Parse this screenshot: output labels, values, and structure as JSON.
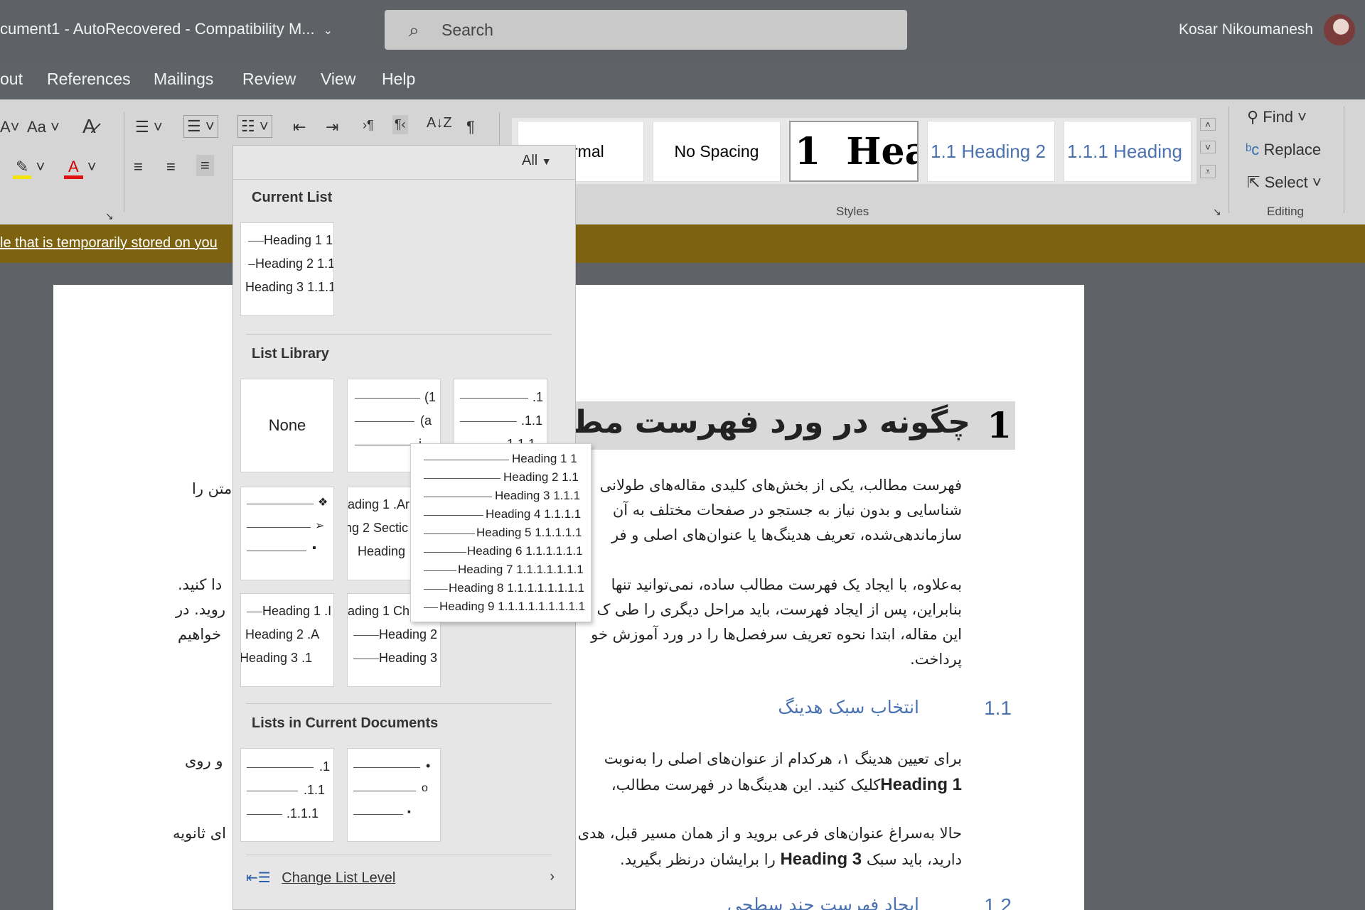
{
  "title_bar": {
    "doc_title": "cument1  -  AutoRecovered  -  Compatibility M...",
    "search_placeholder": "Search",
    "user_name": "Kosar Nikoumanesh"
  },
  "menu": [
    "out",
    "References",
    "Mailings",
    "Review",
    "View",
    "Help"
  ],
  "ribbon": {
    "font_case": "Aa",
    "styles": {
      "normal": "rmal",
      "no_spacing": "No Spacing",
      "heading1_num": "1",
      "heading1": "Head",
      "heading2": "1.1  Heading 2",
      "heading3": "1.1.1  Heading"
    },
    "styles_label": "Styles",
    "editing": {
      "find": "Find",
      "replace": "Replace",
      "select": "Select",
      "label": "Editing"
    }
  },
  "notification": "le that is temporarily stored on you",
  "dropdown": {
    "filter": "All",
    "current_list_header": "Current List",
    "current_list": [
      "Heading 1 1",
      "Heading 2 1.1",
      "Heading 3 1.1.1"
    ],
    "library_header": "List Library",
    "none_label": "None",
    "tile_paren": [
      "(1",
      "(a",
      "i"
    ],
    "tile_decimal": [
      ".1",
      ".1.1",
      "1.1.1"
    ],
    "tile_article": [
      "ading 1 .Ar",
      "ng 2 Sectic",
      "Heading"
    ],
    "tile_heading_letters": [
      "Heading 1 .I",
      "Heading 2 .A",
      "Heading 3 .1"
    ],
    "tile_chapter": [
      "ading 1 Cha",
      "Heading 2",
      "Heading 3"
    ],
    "docs_header": "Lists in Current Documents",
    "docs_tile_decimal": [
      ".1",
      ".1.1",
      ".1.1.1"
    ],
    "docs_tile_bullet": [
      "•",
      "o",
      "▪"
    ],
    "change_level": "Change List Level"
  },
  "preview": [
    "Heading 1 1",
    "Heading 2 1.1",
    "Heading 3 1.1.1",
    "Heading 4 1.1.1.1",
    "Heading 5 1.1.1.1.1",
    "Heading 6 1.1.1.1.1.1",
    "Heading 7 1.1.1.1.1.1.1",
    "Heading 8 1.1.1.1.1.1.1.1",
    "Heading 9 1.1.1.1.1.1.1.1.1"
  ],
  "document": {
    "heading1_num": "1",
    "heading1_text": "چگونه در ورد فهرست مط",
    "para1": [
      "فهرست مطالب، یکی از بخش‌های کلیدی مقاله‌های طولانی",
      "شناسایی و بدون نیاز به جستجو در صفحات مختلف به آن",
      "سازماندهی‌شده، تعریف هدینگ‌ها یا عنوان‌های اصلی و فر"
    ],
    "left_frag1": "متن را",
    "para2": [
      "به‌علاوه، با ایجاد یک فهرست مطالب ساده، نمی‌توانید تنها",
      "بنابراین، پس از ایجاد فهرست، باید مراحل دیگری را طی ک",
      "این مقاله، ابتدا نحوه تعریف سرفصل‌ها را در ورد آموزش خو",
      "پرداخت."
    ],
    "left_frag2": [
      "دا کنید.",
      "روید. در",
      "خواهیم"
    ],
    "heading2_num": "1.1",
    "heading2_text": "انتخاب سبک هدینگ",
    "para3_line1": "برای تعیین هدینگ ۱، هرکدام از عنوان‌های اصلی را به‌نوبت",
    "para3_line2_bold": "Heading 1",
    "para3_line2": "کلیک کنید. این هدینگ‌ها در فهرست مطالب،",
    "left_frag3": "و روی",
    "para4_line1": "حالا به‌سراغ عنوان‌های فرعی بروید و از همان مسیر قبل، هدی",
    "para4_line2_a": "دارید، باید سبک",
    "para4_line2_bold": "Heading 3",
    "para4_line2_b": "را برایشان درنظر بگیرید.",
    "left_frag4": "ای ثانویه",
    "heading3_num": "1.2",
    "heading3_text": "ایجاد فهرست چند سطحی"
  }
}
